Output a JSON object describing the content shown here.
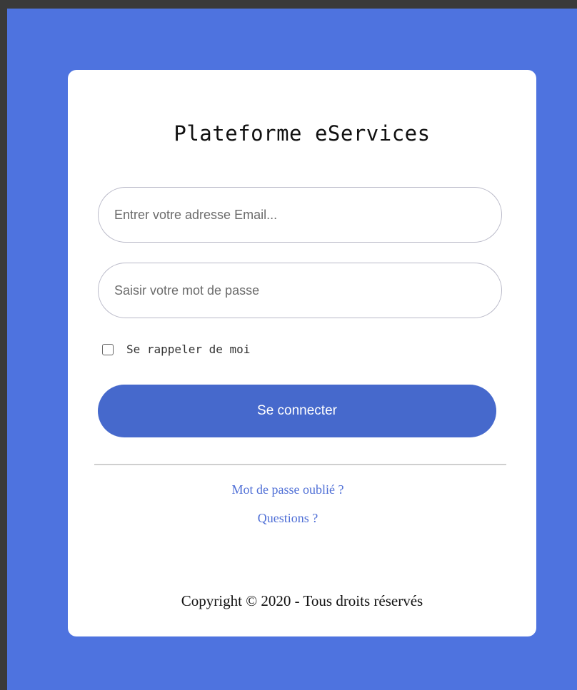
{
  "login": {
    "title": "Plateforme eServices",
    "email_placeholder": "Entrer votre adresse Email...",
    "password_placeholder": "Saisir votre mot de passe",
    "remember_label": "Se rappeler de moi",
    "remember_checked": false,
    "submit_label": "Se connecter",
    "forgot_link": "Mot de passe oublié ?",
    "questions_link": "Questions ?",
    "copyright": "Copyright © 2020 - Tous droits réservés"
  },
  "colors": {
    "background": "#4e73df",
    "button": "#4669cc",
    "link": "#4f6fd6",
    "card": "#ffffff"
  }
}
